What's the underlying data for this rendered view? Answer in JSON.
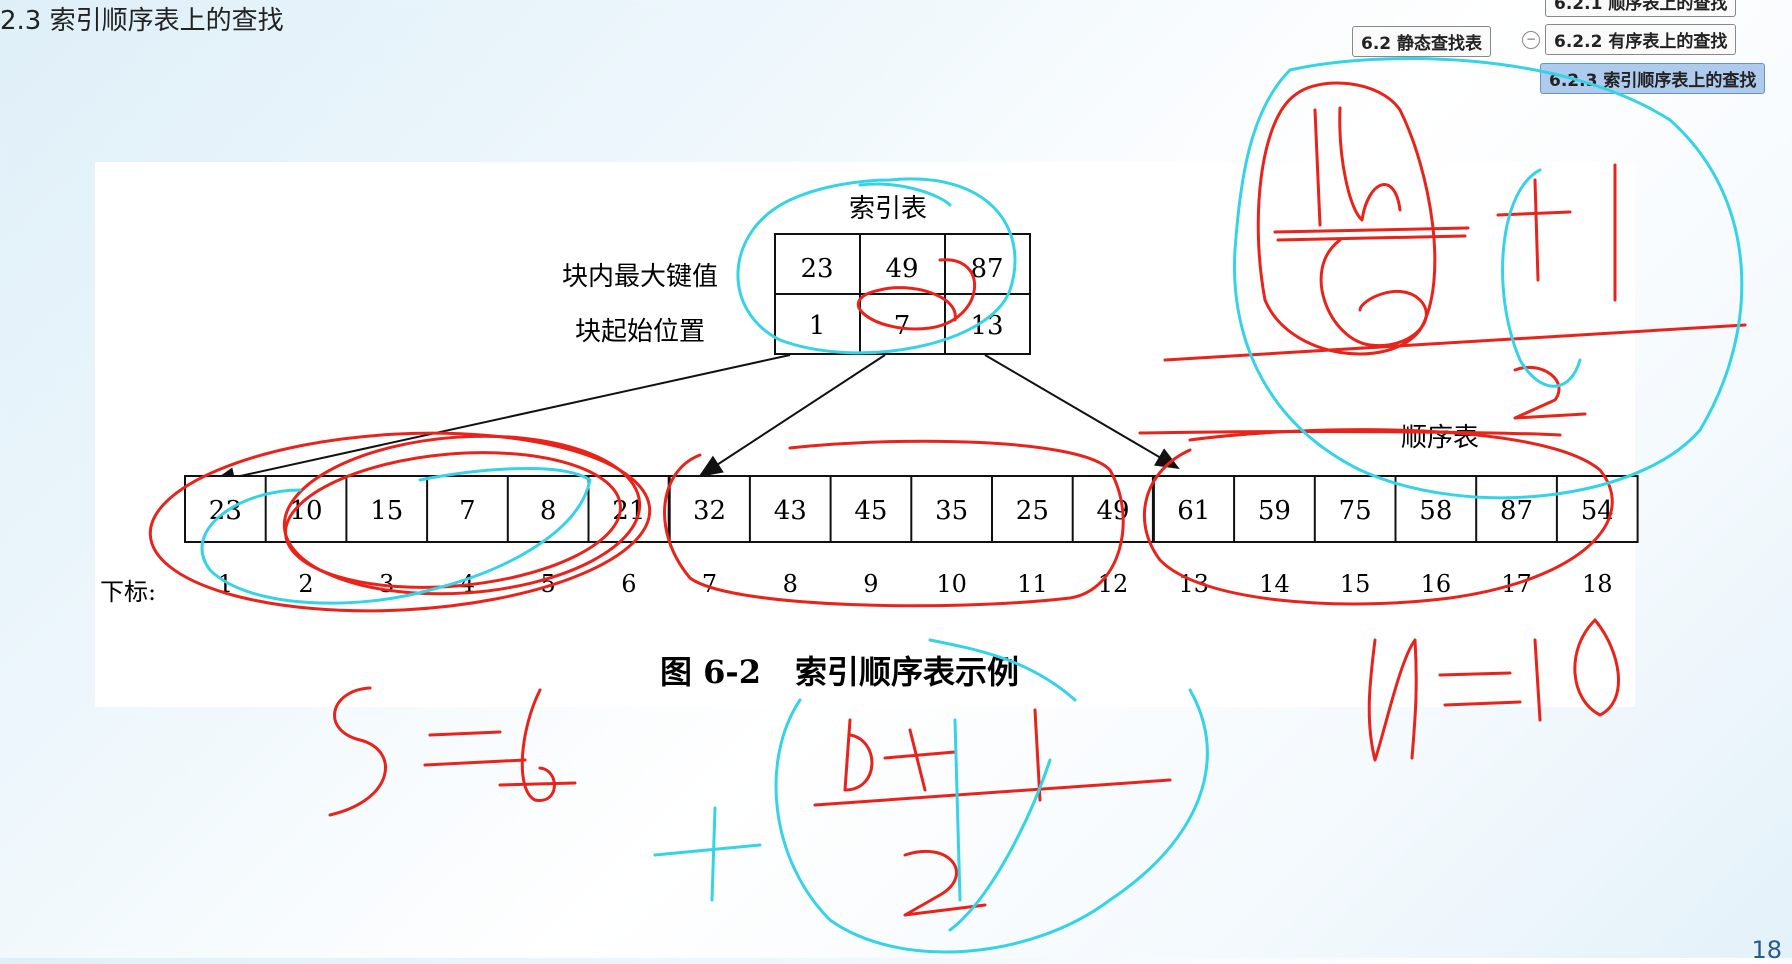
{
  "slide_title": "2.3 索引顺序表上的查找",
  "nav": {
    "top_item": "6.2.1 顺序表上的查找",
    "parent": "6.2 静态查找表",
    "connector": "−",
    "item_ordered": "6.2.2 有序表上的查找",
    "item_indexed": "6.2.3 索引顺序表上的查找"
  },
  "index_table": {
    "title": "索引表",
    "row_labels": [
      "块内最大键值",
      "块起始位置"
    ],
    "max_keys": [
      "23",
      "49",
      "87"
    ],
    "start_positions": [
      "1",
      "7",
      "13"
    ]
  },
  "sequence_table": {
    "title": "顺序表",
    "values": [
      "23",
      "10",
      "15",
      "7",
      "8",
      "21",
      "32",
      "43",
      "45",
      "35",
      "25",
      "49",
      "61",
      "59",
      "75",
      "58",
      "87",
      "54"
    ],
    "index_label": "下标:",
    "indices": [
      "1",
      "2",
      "3",
      "4",
      "5",
      "6",
      "7",
      "8",
      "9",
      "10",
      "11",
      "12",
      "13",
      "14",
      "15",
      "16",
      "17",
      "18"
    ]
  },
  "caption": {
    "figure": "图 6-2",
    "text": "索引顺序表示例"
  },
  "page_number": "18",
  "colors": {
    "red_ink": "#e8231c",
    "cyan_ink": "#36d3e6",
    "nav_active": "#aecbee",
    "page_number": "#2a5a8a"
  }
}
